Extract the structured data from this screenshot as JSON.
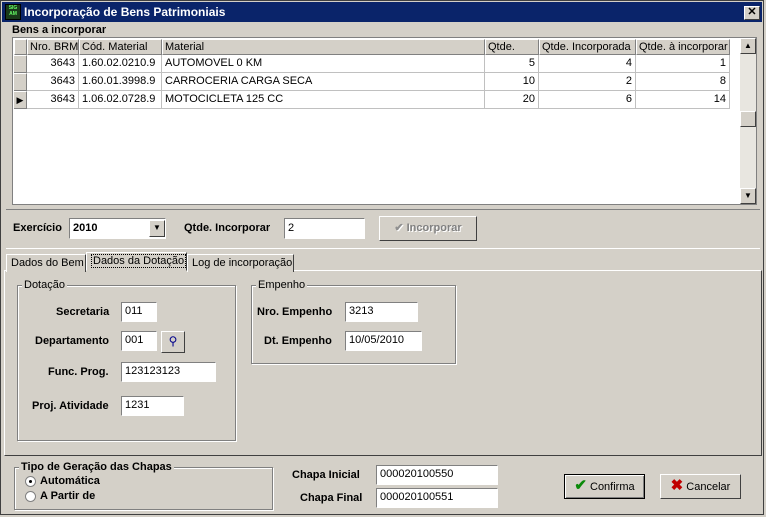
{
  "window": {
    "title": "Incorporação de Bens Patrimoniais",
    "close": "✕"
  },
  "grid": {
    "section_label": "Bens a incorporar",
    "columns": [
      "Nro. BRM",
      "Cód. Material",
      "Material",
      "Qtde.",
      "Qtde. Incorporada",
      "Qtde. à incorporar"
    ],
    "rows": [
      [
        "3643",
        "1.60.02.0210.9",
        "AUTOMOVEL 0 KM",
        "5",
        "4",
        "1"
      ],
      [
        "3643",
        "1.60.01.3998.9",
        "CARROCERIA CARGA SECA",
        "10",
        "2",
        "8"
      ],
      [
        "3643",
        "1.06.02.0728.9",
        "MOTOCICLETA 125 CC",
        "20",
        "6",
        "14"
      ]
    ],
    "current_row_marker": "▶"
  },
  "toolbar": {
    "exercicio_label": "Exercício",
    "exercicio_value": "2010",
    "qtde_label": "Qtde. Incorporar",
    "qtde_value": "2",
    "incorporar_label": "Incorporar"
  },
  "tabs": [
    "Dados do Bem",
    "Dados da Dotação",
    "Log de incorporação"
  ],
  "dotacao": {
    "title": "Dotação",
    "secretaria_label": "Secretaria",
    "secretaria_value": "011",
    "departamento_label": "Departamento",
    "departamento_value": "001",
    "func_prog_label": "Func. Prog.",
    "func_prog_value": "123123123",
    "proj_atividade_label": "Proj. Atividade",
    "proj_atividade_value": "1231"
  },
  "empenho": {
    "title": "Empenho",
    "nro_label": "Nro. Empenho",
    "nro_value": "3213",
    "dt_label": "Dt. Empenho",
    "dt_value": "10/05/2010"
  },
  "chapas": {
    "title": "Tipo de Geração das Chapas",
    "option_auto": "Automática",
    "option_partir": "A Partir de",
    "inicial_label": "Chapa Inicial",
    "inicial_value": "000020100550",
    "final_label": "Chapa Final",
    "final_value": "000020100551"
  },
  "actions": {
    "confirma": "Confirma",
    "cancelar": "Cancelar"
  },
  "icons": {
    "check": "check-icon",
    "cancel": "x-icon",
    "lookup": "flashlight-icon",
    "dropdown": "chevron-down-icon"
  }
}
